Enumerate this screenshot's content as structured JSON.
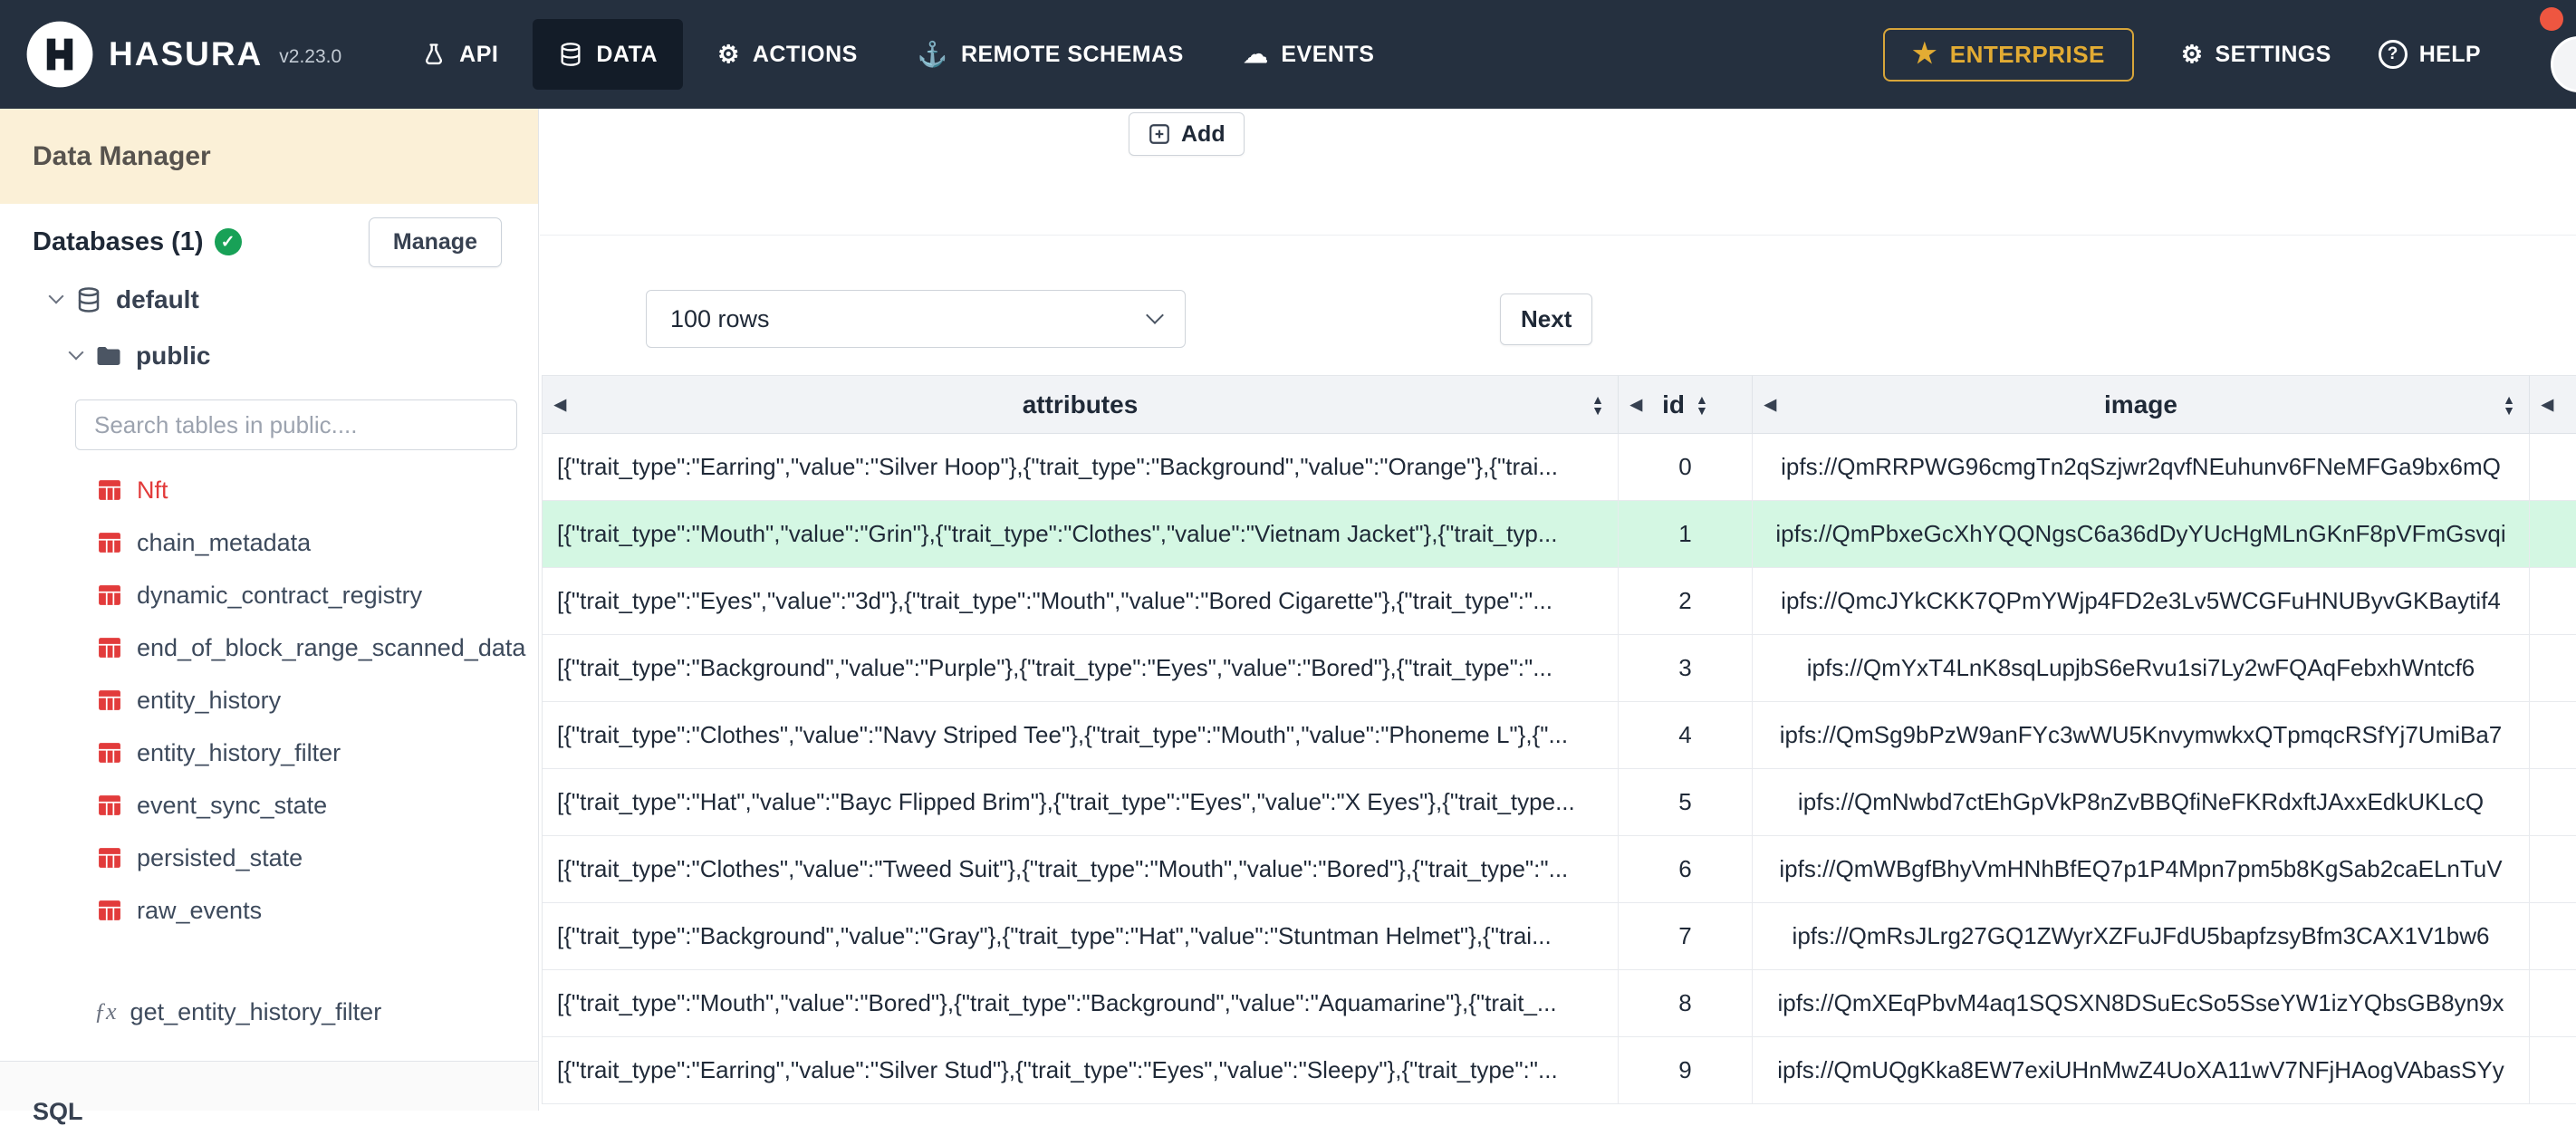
{
  "navbar": {
    "brand": "HASURA",
    "version": "v2.23.0",
    "items": [
      {
        "label": "API",
        "icon": "flask-icon"
      },
      {
        "label": "DATA",
        "icon": "database-icon"
      },
      {
        "label": "ACTIONS",
        "icon": "gear-icon"
      },
      {
        "label": "REMOTE SCHEMAS",
        "icon": "anchor-icon"
      },
      {
        "label": "EVENTS",
        "icon": "cloud-icon"
      }
    ],
    "enterprise_label": "ENTERPRISE",
    "settings_label": "SETTINGS",
    "help_label": "HELP"
  },
  "sidebar": {
    "title": "Data Manager",
    "databases_label": "Databases (1)",
    "manage_button": "Manage",
    "tree": {
      "database": "default",
      "schema": "public"
    },
    "search_placeholder": "Search tables in public....",
    "tables": [
      {
        "name": "Nft",
        "active": true
      },
      {
        "name": "chain_metadata"
      },
      {
        "name": "dynamic_contract_registry"
      },
      {
        "name": "end_of_block_range_scanned_data"
      },
      {
        "name": "entity_history"
      },
      {
        "name": "entity_history_filter"
      },
      {
        "name": "event_sync_state"
      },
      {
        "name": "persisted_state"
      },
      {
        "name": "raw_events"
      }
    ],
    "functions": [
      {
        "name": "get_entity_history_filter"
      }
    ],
    "footer_partial": "SQL"
  },
  "main": {
    "add_button": "Add",
    "rows_select_value": "100 rows",
    "next_button": "Next",
    "table": {
      "columns": [
        {
          "label": "attributes"
        },
        {
          "label": "id"
        },
        {
          "label": "image"
        }
      ],
      "highlighted_row_index": 1,
      "rows": [
        {
          "attributes": "[{\"trait_type\":\"Earring\",\"value\":\"Silver Hoop\"},{\"trait_type\":\"Background\",\"value\":\"Orange\"},{\"trai...",
          "id": "0",
          "image": "ipfs://QmRRPWG96cmgTn2qSzjwr2qvfNEuhunv6FNeMFGa9bx6mQ"
        },
        {
          "attributes": "[{\"trait_type\":\"Mouth\",\"value\":\"Grin\"},{\"trait_type\":\"Clothes\",\"value\":\"Vietnam Jacket\"},{\"trait_typ...",
          "id": "1",
          "image": "ipfs://QmPbxeGcXhYQQNgsC6a36dDyYUcHgMLnGKnF8pVFmGsvqi"
        },
        {
          "attributes": "[{\"trait_type\":\"Eyes\",\"value\":\"3d\"},{\"trait_type\":\"Mouth\",\"value\":\"Bored Cigarette\"},{\"trait_type\":\"...",
          "id": "2",
          "image": "ipfs://QmcJYkCKK7QPmYWjp4FD2e3Lv5WCGFuHNUByvGKBaytif4"
        },
        {
          "attributes": "[{\"trait_type\":\"Background\",\"value\":\"Purple\"},{\"trait_type\":\"Eyes\",\"value\":\"Bored\"},{\"trait_type\":\"...",
          "id": "3",
          "image": "ipfs://QmYxT4LnK8sqLupjbS6eRvu1si7Ly2wFQAqFebxhWntcf6"
        },
        {
          "attributes": "[{\"trait_type\":\"Clothes\",\"value\":\"Navy Striped Tee\"},{\"trait_type\":\"Mouth\",\"value\":\"Phoneme L\"},{\"...",
          "id": "4",
          "image": "ipfs://QmSg9bPzW9anFYc3wWU5KnvymwkxQTpmqcRSfYj7UmiBa7"
        },
        {
          "attributes": "[{\"trait_type\":\"Hat\",\"value\":\"Bayc Flipped Brim\"},{\"trait_type\":\"Eyes\",\"value\":\"X Eyes\"},{\"trait_type...",
          "id": "5",
          "image": "ipfs://QmNwbd7ctEhGpVkP8nZvBBQfiNeFKRdxftJAxxEdkUKLcQ"
        },
        {
          "attributes": "[{\"trait_type\":\"Clothes\",\"value\":\"Tweed Suit\"},{\"trait_type\":\"Mouth\",\"value\":\"Bored\"},{\"trait_type\":\"...",
          "id": "6",
          "image": "ipfs://QmWBgfBhyVmHNhBfEQ7p1P4Mpn7pm5b8KgSab2caELnTuV"
        },
        {
          "attributes": "[{\"trait_type\":\"Background\",\"value\":\"Gray\"},{\"trait_type\":\"Hat\",\"value\":\"Stuntman Helmet\"},{\"trai...",
          "id": "7",
          "image": "ipfs://QmRsJLrg27GQ1ZWyrXZFuJFdU5bapfzsyBfm3CAX1V1bw6"
        },
        {
          "attributes": "[{\"trait_type\":\"Mouth\",\"value\":\"Bored\"},{\"trait_type\":\"Background\",\"value\":\"Aquamarine\"},{\"trait_...",
          "id": "8",
          "image": "ipfs://QmXEqPbvM4aq1SQSXN8DSuEcSo5SseYW1izYQbsGB8yn9x"
        },
        {
          "attributes": "[{\"trait_type\":\"Earring\",\"value\":\"Silver Stud\"},{\"trait_type\":\"Eyes\",\"value\":\"Sleepy\"},{\"trait_type\":\"...",
          "id": "9",
          "image": "ipfs://QmUQgKka8EW7exiUHnMwZ4UoXA11wV7NFjHAogVAbasSYy"
        }
      ]
    }
  },
  "colors": {
    "navbar_bg": "#25303f",
    "enterprise_gold": "#e3ac33",
    "sidebar_header_bg": "#fbf0d7",
    "active_table_red": "#e23b3b",
    "highlight_row_green": "#d4f7e3"
  }
}
